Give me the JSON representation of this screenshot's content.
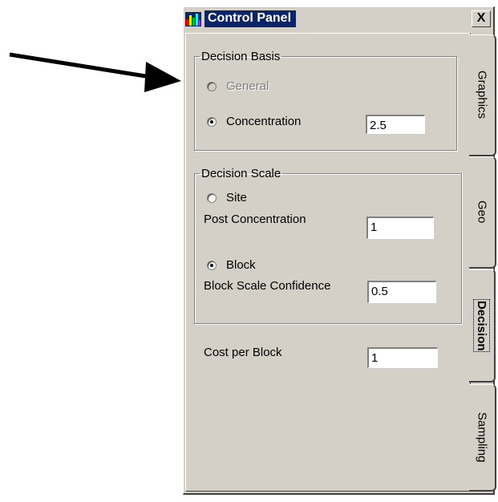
{
  "window": {
    "title": "Control Panel",
    "close_glyph": "X",
    "icon": "bar-chart-icon"
  },
  "decision_basis": {
    "legend": "Decision Basis",
    "general_label": "General",
    "general_enabled": false,
    "concentration_label": "Concentration",
    "concentration_value": "2.5",
    "selected": "concentration"
  },
  "decision_scale": {
    "legend": "Decision Scale",
    "site_label": "Site",
    "post_concentration_label": "Post Concentration",
    "post_concentration_value": "1",
    "block_label": "Block",
    "block_scale_confidence_label": "Block Scale Confidence",
    "block_scale_confidence_value": "0.5",
    "selected": "block"
  },
  "cost": {
    "label": "Cost per Block",
    "value": "1"
  },
  "tabs": [
    {
      "label": "Graphics",
      "active": false
    },
    {
      "label": "Geo",
      "active": false
    },
    {
      "label": "Decision",
      "active": true
    },
    {
      "label": "Sampling",
      "active": false
    }
  ],
  "colors": {
    "face": "#d4d0c8",
    "title_highlight": "#0a246a"
  }
}
